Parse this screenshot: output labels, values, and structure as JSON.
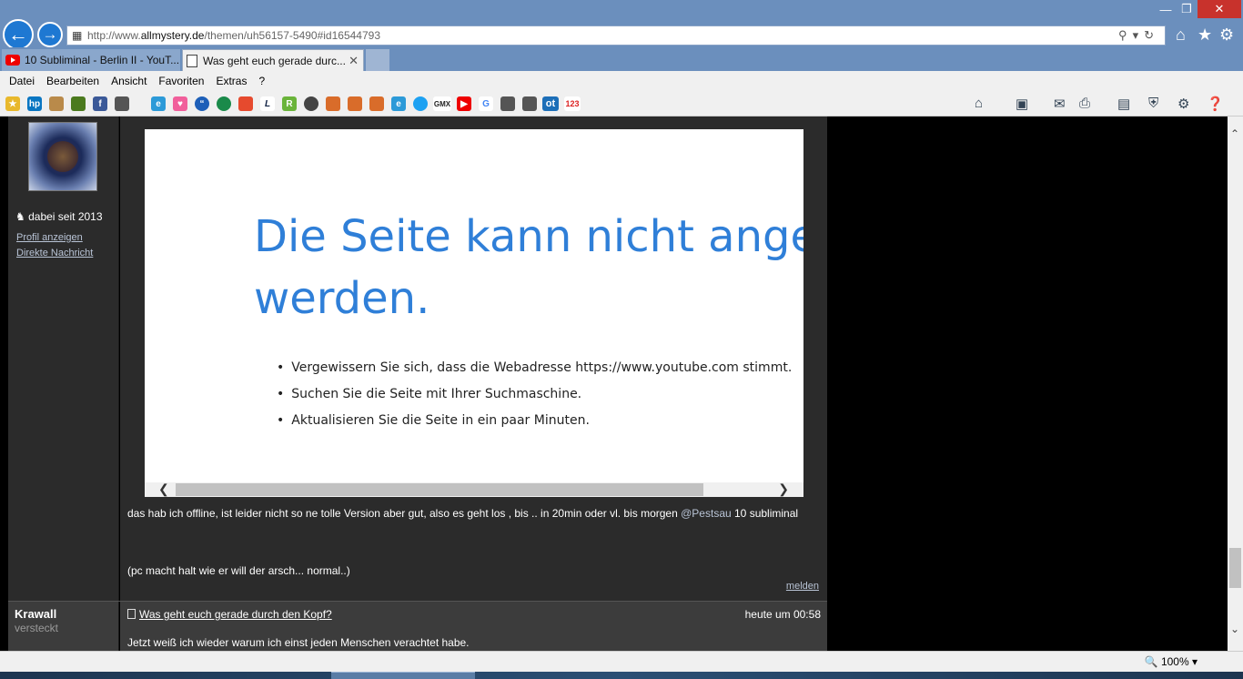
{
  "browser": {
    "address": {
      "prefix": "http://www.",
      "domain": "allmystery.de",
      "path": "/themen/uh56157-5490#id16544793"
    },
    "tabs": [
      {
        "label": "10 Subliminal - Berlin II - YouT..."
      },
      {
        "label": "Was geht euch gerade durc..."
      }
    ],
    "menu": [
      "Datei",
      "Bearbeiten",
      "Ansicht",
      "Favoriten",
      "Extras",
      "?"
    ],
    "zoom": "100%"
  },
  "post1": {
    "member_since": "dabei seit 2013",
    "links": [
      "Profil anzeigen",
      "Direkte Nachricht"
    ],
    "embed": {
      "heading": "Die Seite kann nicht angezeigt werden.",
      "heading_line1": "Die Seite kann nicht angezeig",
      "heading_line2": "werden.",
      "bullets": [
        "Vergewissern Sie sich, dass die Webadresse https://www.youtube.com stimmt.",
        "Suchen Sie die Seite mit Ihrer Suchmaschine.",
        "Aktualisieren Sie die Seite in ein paar Minuten."
      ]
    },
    "text_before": "das hab ich offline, ist leider nicht so ne tolle Version aber gut, also es geht los , bis .. in 20min oder vl. bis morgen ",
    "mention": "@Pestsau",
    "text_after": " 10 subliminal",
    "text2": "(pc macht halt wie er will der arsch... normal..)",
    "report": "melden"
  },
  "post2": {
    "username": "Krawall",
    "status": "versteckt",
    "title": "Was geht euch gerade durch den Kopf?",
    "time": "heute um 00:58",
    "text": "Jetzt weiß ich wieder warum ich einst jeden Menschen verachtet habe."
  },
  "colors": {
    "titlebar": "#6b8fbd",
    "forum_bg": "#2b2b2b",
    "link": "#b9c4d6",
    "error_heading": "#2f7fd8"
  },
  "icons": [
    "back-arrow-icon",
    "forward-arrow-icon",
    "home-icon",
    "star-icon",
    "gear-icon",
    "search-icon",
    "refresh-icon",
    "close-icon"
  ]
}
